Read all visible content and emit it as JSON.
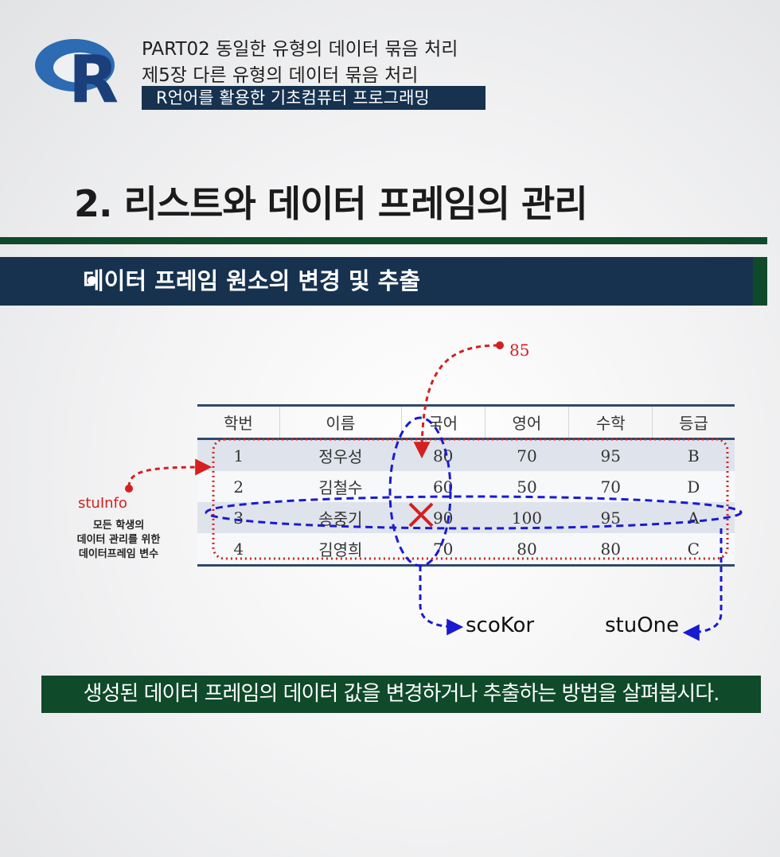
{
  "header": {
    "logo_letter": "R",
    "line1": "PART02 동일한 유형의 데이터 묶음 처리",
    "line2": "제5장 다른 유형의 데이터 묶음 처리",
    "course": "R언어를 활용한 기초컴퓨터 프로그래밍"
  },
  "slide": {
    "title": "2. 리스트와 데이터 프레임의 관리",
    "section": "데이터 프레임 원소의 변경 및 추출",
    "caption": "생성된 데이터 프레임의 데이터 값을 변경하거나 추출하는 방법을 살펴봅시다."
  },
  "table": {
    "headers": [
      "학번",
      "이름",
      "국어",
      "영어",
      "수학",
      "등급"
    ],
    "rows": [
      [
        "1",
        "정우성",
        "80",
        "70",
        "95",
        "B"
      ],
      [
        "2",
        "김철수",
        "60",
        "50",
        "70",
        "D"
      ],
      [
        "3",
        "송중기",
        "90",
        "100",
        "95",
        "A"
      ],
      [
        "4",
        "김영희",
        "70",
        "80",
        "80",
        "C"
      ]
    ]
  },
  "annotations": {
    "new_value": "85",
    "stuinfo_label": "stuInfo",
    "stuinfo_desc": [
      "모든 학생의",
      "데이터 관리를 위한",
      "데이터프레임 변수"
    ],
    "scokor_label": "scoKor",
    "stuone_label": "stuOne"
  },
  "colors": {
    "navy": "#16324f",
    "green": "#0f4a2a",
    "red": "#d42020",
    "blue": "#1a1ad0"
  }
}
